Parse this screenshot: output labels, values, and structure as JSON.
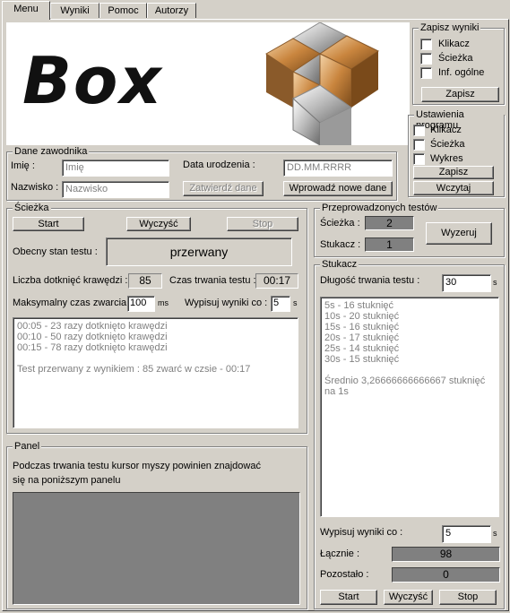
{
  "tabs": [
    "Menu",
    "Wyniki",
    "Pomoc",
    "Autorzy"
  ],
  "logo": {
    "text": "Box"
  },
  "zapisz_wyniki": {
    "title": "Zapisz wyniki",
    "options": [
      "Klikacz",
      "Ścieżka",
      "Inf. ogólne"
    ],
    "button": "Zapisz"
  },
  "ustawienia": {
    "title": "Ustawienia programu",
    "options": [
      "Klikacz",
      "Ścieżka",
      "Wykres"
    ],
    "save_button": "Zapisz",
    "load_button": "Wczytaj"
  },
  "dane_zawodnika": {
    "title": "Dane zawodnika",
    "imie_label": "Imię :",
    "imie_placeholder": "Imię",
    "nazwisko_label": "Nazwisko :",
    "nazwisko_placeholder": "Nazwisko",
    "data_label": "Data urodzenia :",
    "data_placeholder": "DD.MM.RRRR",
    "confirm_button": "Zatwierdź dane",
    "new_button": "Wprowadź nowe dane"
  },
  "sciezka": {
    "title": "Ścieżka",
    "start": "Start",
    "clear": "Wyczyść",
    "stop": "Stop",
    "state_label": "Obecny stan testu :",
    "state_value": "przerwany",
    "touches_label": "Liczba dotknięć krawędzi :",
    "touches_value": "85",
    "time_label": "Czas trwania testu :",
    "time_value": "00:17",
    "max_label": "Maksymalny czas zwarcia :",
    "max_value": "100",
    "max_unit": "ms",
    "write_label": "Wypisuj wyniki co :",
    "write_value": "5",
    "write_unit": "s",
    "log": [
      "00:05 - 23 razy dotknięto krawędzi",
      "00:10 - 50 razy dotknięto krawędzi",
      "00:15 - 78 razy dotknięto krawędzi",
      "",
      "Test przerwany z wynikiem : 85 zwarć w czsie - 00:17"
    ]
  },
  "przeprowadzonych": {
    "title": "Przeprowadzonych testów",
    "sciezka_label": "Ścieżka :",
    "sciezka_value": "2",
    "stukacz_label": "Stukacz :",
    "stukacz_value": "1",
    "reset_button": "Wyzeruj"
  },
  "stukacz": {
    "title": "Stukacz",
    "duration_label": "Długość trwania testu :",
    "duration_value": "30",
    "duration_unit": "s",
    "log": [
      "5s - 16 stuknięć",
      "10s - 20 stuknięć",
      "15s - 16 stuknięć",
      "20s - 17 stuknięć",
      "25s - 14 stuknięć",
      "30s - 15 stuknięć",
      "",
      "Średnio 3,26666666666667 stuknięć",
      "na 1s"
    ],
    "write_label": "Wypisuj wyniki co :",
    "write_value": "5",
    "write_unit": "s",
    "total_label": "Łącznie :",
    "total_value": "98",
    "remaining_label": "Pozostało :",
    "remaining_value": "0",
    "start": "Start",
    "clear": "Wyczyść",
    "stop": "Stop"
  },
  "panel": {
    "title": "Panel",
    "text_line1": "Podczas trwania testu kursor myszy powinien znajdować",
    "text_line2": "się na poniższym panelu"
  },
  "colors": {
    "face": "#d4d0c8",
    "dark": "#808080",
    "white": "#ffffff"
  }
}
